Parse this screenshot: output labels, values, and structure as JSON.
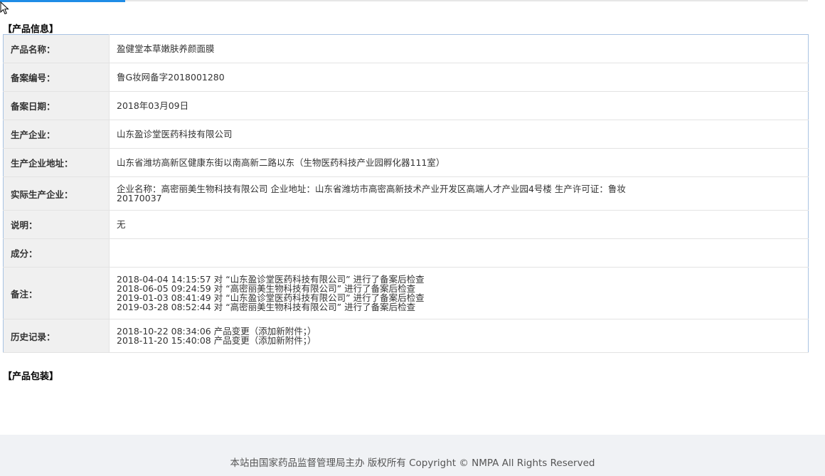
{
  "sections": {
    "product_info": "【产品信息】",
    "product_packaging": "【产品包装】"
  },
  "rows": [
    {
      "label": "产品名称：",
      "lines": [
        "盈健堂本草嫩肤养颜面膜"
      ]
    },
    {
      "label": "备案编号：",
      "lines": [
        "鲁G妆网备字2018001280"
      ]
    },
    {
      "label": "备案日期：",
      "lines": [
        "2018年03月09日"
      ]
    },
    {
      "label": "生产企业：",
      "lines": [
        "山东盈诊堂医药科技有限公司"
      ]
    },
    {
      "label": "生产企业地址：",
      "lines": [
        "山东省潍坊高新区健康东街以南高新二路以东（生物医药科技产业园孵化器111室）"
      ]
    },
    {
      "label": "实际生产企业：",
      "lines": [
        "企业名称：高密丽美生物科技有限公司 企业地址：山东省潍坊市高密高新技术产业开发区高端人才产业园4号楼 生产许可证：鲁妆",
        "20170037"
      ]
    },
    {
      "label": "说明：",
      "lines": [
        "无"
      ]
    },
    {
      "label": "成分：",
      "lines": []
    },
    {
      "label": "备注：",
      "lines": [
        "2018-04-04 14:15:57 对 “山东盈诊堂医药科技有限公司” 进行了备案后检查",
        "2018-06-05 09:24:59 对 “高密丽美生物科技有限公司” 进行了备案后检查",
        "2019-01-03 08:41:49 对 “山东盈诊堂医药科技有限公司” 进行了备案后检查",
        "2019-03-28 08:52:44 对 “高密丽美生物科技有限公司” 进行了备案后检查"
      ]
    },
    {
      "label": "历史记录：",
      "lines": [
        "2018-10-22 08:34:06 产品变更（添加新附件；）",
        "2018-11-20 15:40:08 产品变更（添加新附件；）"
      ]
    }
  ],
  "footer": {
    "text": "本站由国家药品监督管理局主办 版权所有 Copyright © NMPA All Rights Reserved"
  }
}
